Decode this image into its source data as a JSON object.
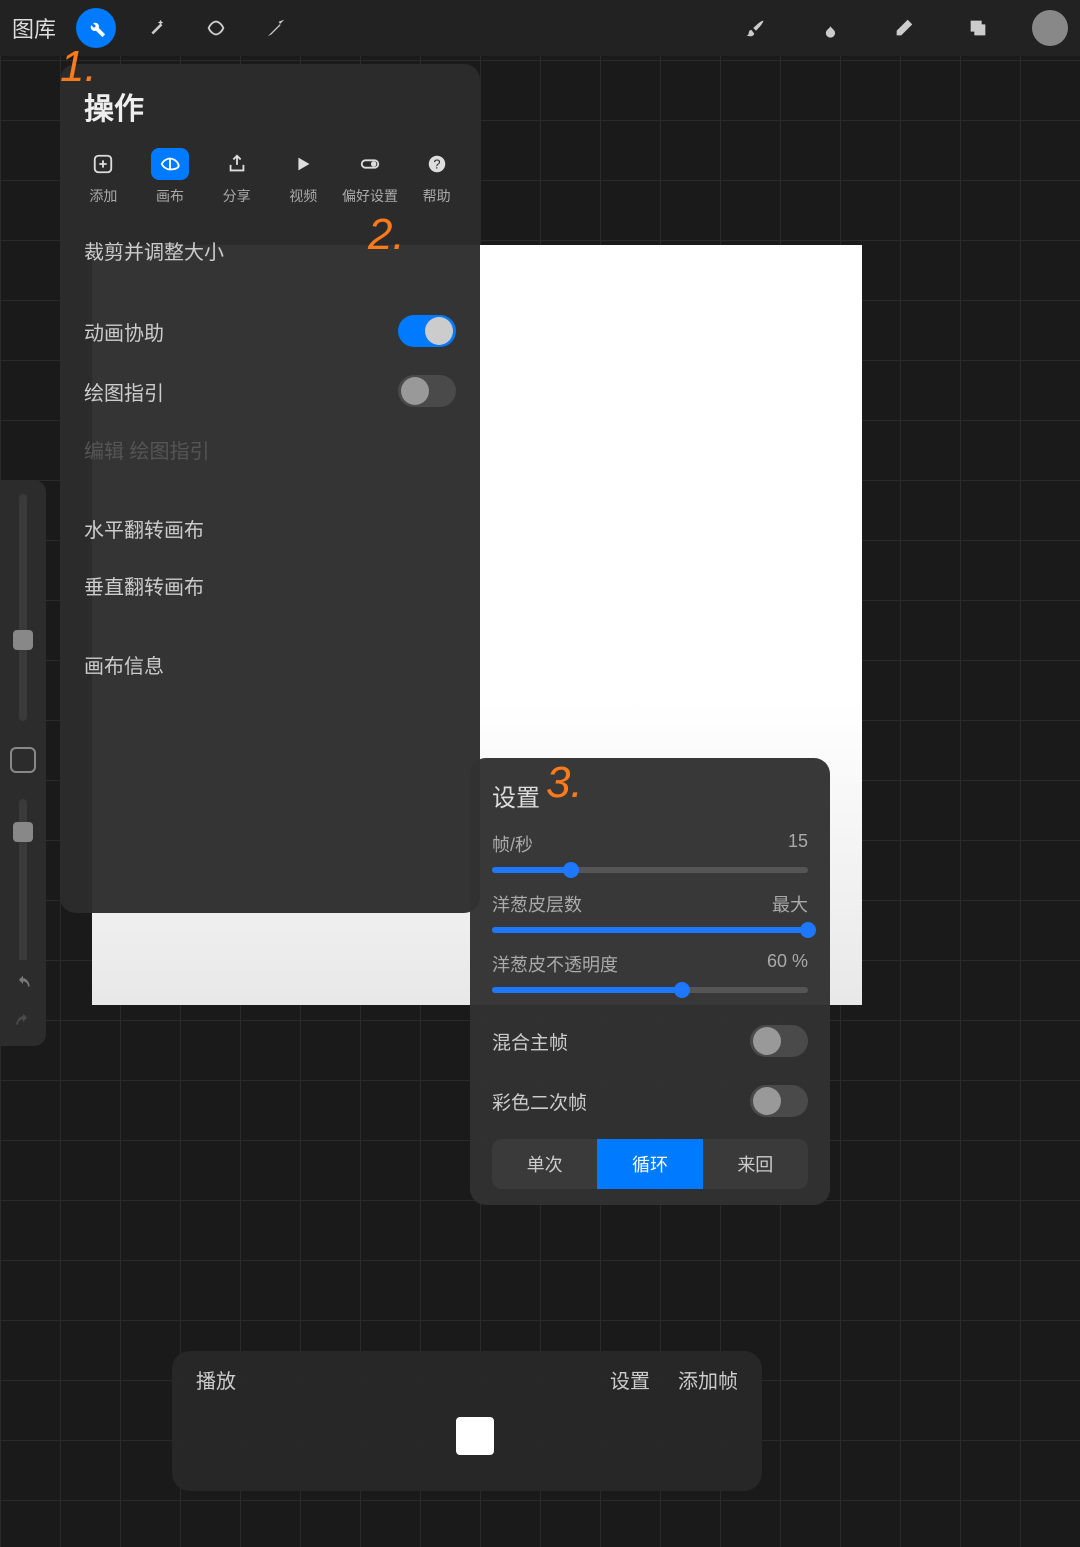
{
  "topbar": {
    "gallery": "图库"
  },
  "panel": {
    "title": "操作",
    "tabs": [
      {
        "label": "添加"
      },
      {
        "label": "画布"
      },
      {
        "label": "分享"
      },
      {
        "label": "视频"
      },
      {
        "label": "偏好设置"
      },
      {
        "label": "帮助"
      }
    ],
    "crop": "裁剪并调整大小",
    "anim_assist": "动画协助",
    "draw_guide": "绘图指引",
    "edit_guide": "编辑 绘图指引",
    "flip_h": "水平翻转画布",
    "flip_v": "垂直翻转画布",
    "canvas_info": "画布信息"
  },
  "annotations": {
    "a1": "1.",
    "a2": "2.",
    "a3": "3."
  },
  "settings": {
    "title": "设置",
    "fps_label": "帧/秒",
    "fps_value": "15",
    "onion_layers_label": "洋葱皮层数",
    "onion_layers_value": "最大",
    "onion_opacity_label": "洋葱皮不透明度",
    "onion_opacity_value": "60 %",
    "blend_main": "混合主帧",
    "color_secondary": "彩色二次帧",
    "seg_once": "单次",
    "seg_loop": "循环",
    "seg_pingpong": "来回"
  },
  "bottombar": {
    "play": "播放",
    "settings": "设置",
    "add_frame": "添加帧"
  }
}
